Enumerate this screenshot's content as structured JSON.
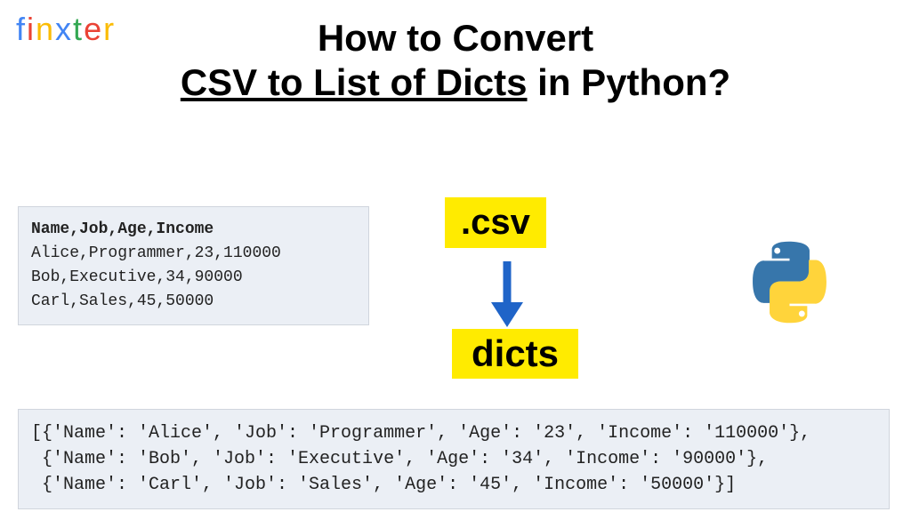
{
  "logo": {
    "letters": [
      "f",
      "i",
      "n",
      "x",
      "t",
      "e",
      "r"
    ]
  },
  "title": {
    "line1": "How to Convert",
    "highlight": "CSV to List of Dicts",
    "suffix": " in Python?"
  },
  "csv": {
    "header": "Name,Job,Age,Income",
    "rows": [
      "Alice,Programmer,23,110000",
      "Bob,Executive,34,90000",
      "Carl,Sales,45,50000"
    ]
  },
  "badges": {
    "csv": ".csv",
    "dicts": "dicts"
  },
  "output": {
    "line1": "[{'Name': 'Alice', 'Job': 'Programmer', 'Age': '23', 'Income': '110000'},",
    "line2": " {'Name': 'Bob', 'Job': 'Executive', 'Age': '34', 'Income': '90000'},",
    "line3": " {'Name': 'Carl', 'Job': 'Sales', 'Age': '45', 'Income': '50000'}]"
  }
}
